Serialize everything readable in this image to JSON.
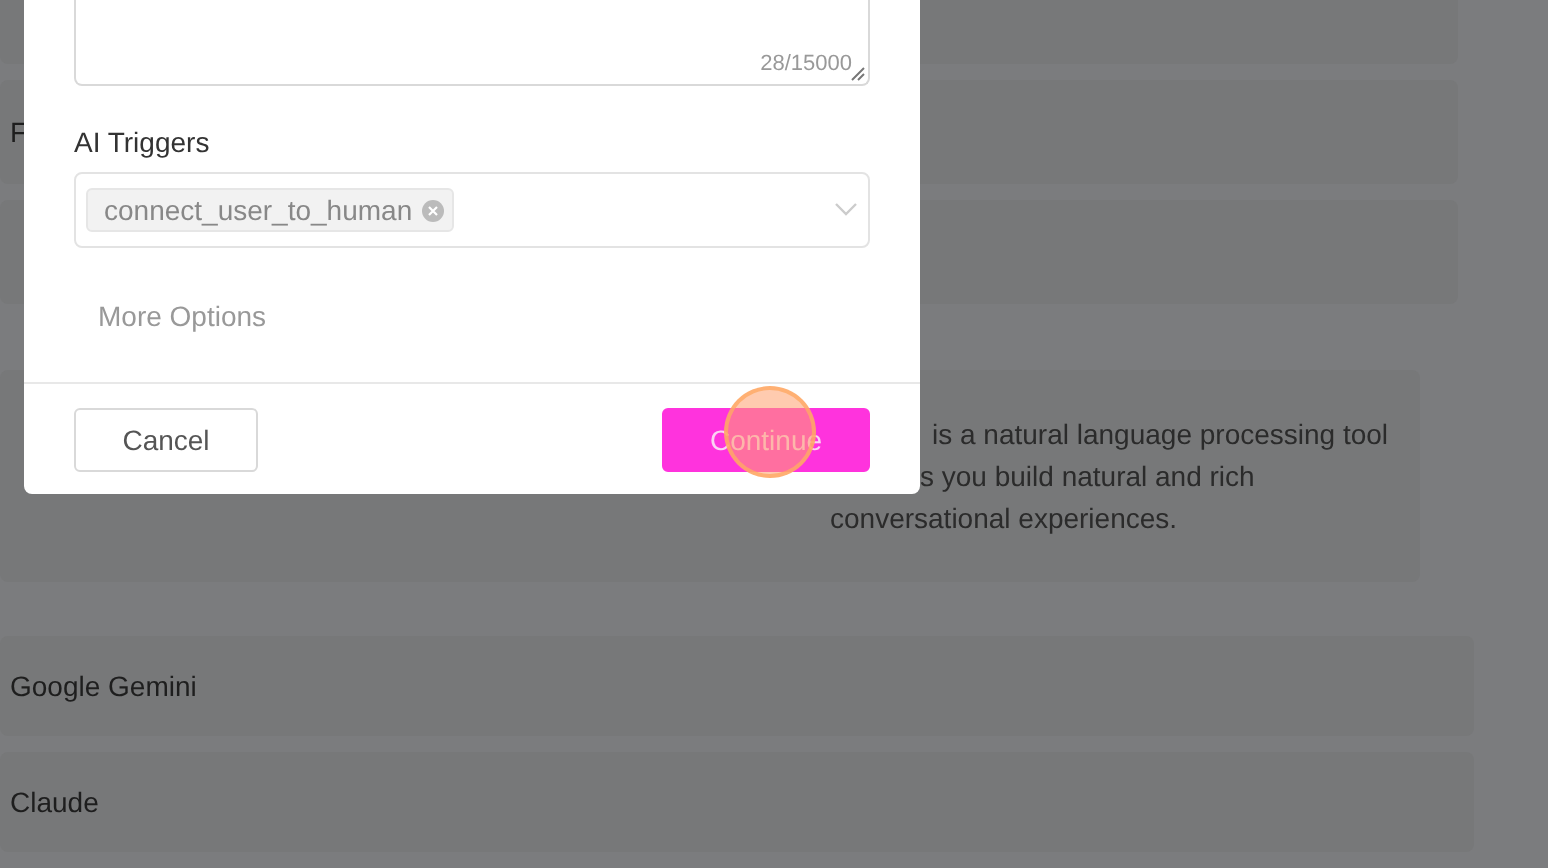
{
  "background": {
    "rows": [
      {
        "label": ""
      },
      {
        "label": "F"
      },
      {
        "label": ""
      }
    ],
    "detail": {
      "lines": [
        "is a natural language processing tool",
        "s you build natural and rich",
        "conversational experiences."
      ]
    },
    "providers": [
      {
        "label": "Google Gemini"
      },
      {
        "label": "Claude"
      }
    ]
  },
  "dialog": {
    "counter": "28/15000",
    "triggers_label": "AI Triggers",
    "triggers": [
      {
        "label": "connect_user_to_human"
      }
    ],
    "more_options": "More Options",
    "buttons": [
      {
        "label": "Cancel",
        "kind": "secondary"
      },
      {
        "label": "Continue",
        "kind": "primary"
      }
    ]
  }
}
